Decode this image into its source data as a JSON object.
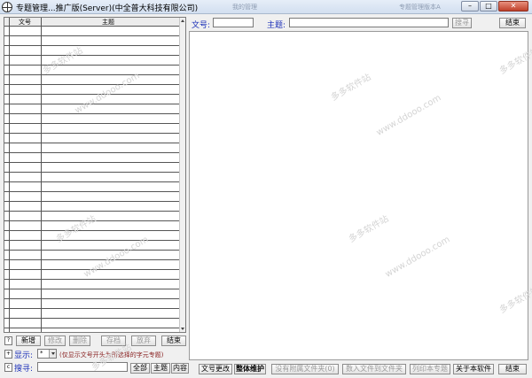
{
  "window": {
    "title": "专题管理...推广版(Server)(中全普大科技有限公司)",
    "ghost_tab_1": "我的管理",
    "ghost_tab_2": "专题管理版本A"
  },
  "table": {
    "columns": [
      "文号",
      "主题"
    ]
  },
  "left_buttons": {
    "new": "新增",
    "edit": "修改",
    "delete": "删除",
    "archive": "存档",
    "discard": "放弃",
    "end": "结束"
  },
  "display_row": {
    "label": "显示:",
    "selected": "*",
    "hint": "(仅显示文号开头为所选择的字元专题)"
  },
  "search_row": {
    "label": "搜寻:",
    "all": "全部",
    "topic": "主题",
    "content": "内容"
  },
  "top_form": {
    "docno_label": "文号:",
    "topic_label": "主题:",
    "search_button": "搜寻",
    "end_button": "结束"
  },
  "bottom_toolbar": {
    "change_docno": "文号更改",
    "maintain": "整体维护",
    "no_attach": "没有附属文件夹(0)",
    "import_file": "数入文件到文件夹",
    "print": "列印本专题",
    "about": "关于本软件",
    "end": "结束"
  },
  "icons": {
    "app": "app-globe-icon",
    "help": "help-icon",
    "expand": "expand-icon",
    "collapse": "collapse-icon"
  },
  "watermark": {
    "text_cn": "多多软件站",
    "text_url": "www.ddooo.com"
  }
}
